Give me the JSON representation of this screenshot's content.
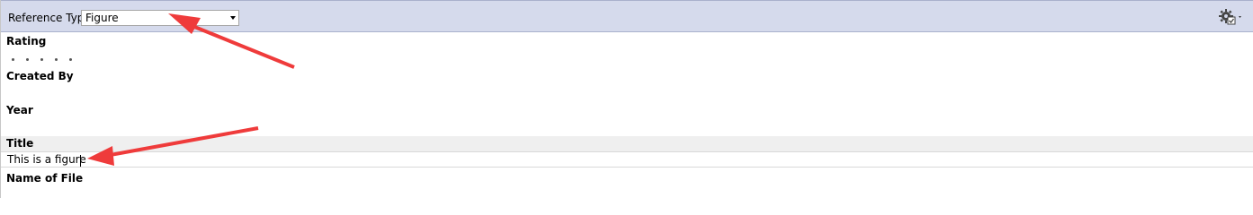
{
  "toolbar": {
    "reference_type_label": "Reference Type:",
    "reference_type_value": "Figure"
  },
  "fields": {
    "rating_label": "Rating",
    "rating_value": 0,
    "rating_max": 5,
    "created_by_label": "Created By",
    "year_label": "Year",
    "title_label": "Title",
    "title_value": "This is a figure",
    "name_of_file_label": "Name of File"
  },
  "colors": {
    "toolbar_bg": "#d5daec",
    "title_band_bg": "#efefef",
    "arrow": "#ef3b3b"
  },
  "icons": [
    "chevron-down-icon",
    "gear-icon",
    "checkbox-icon"
  ]
}
